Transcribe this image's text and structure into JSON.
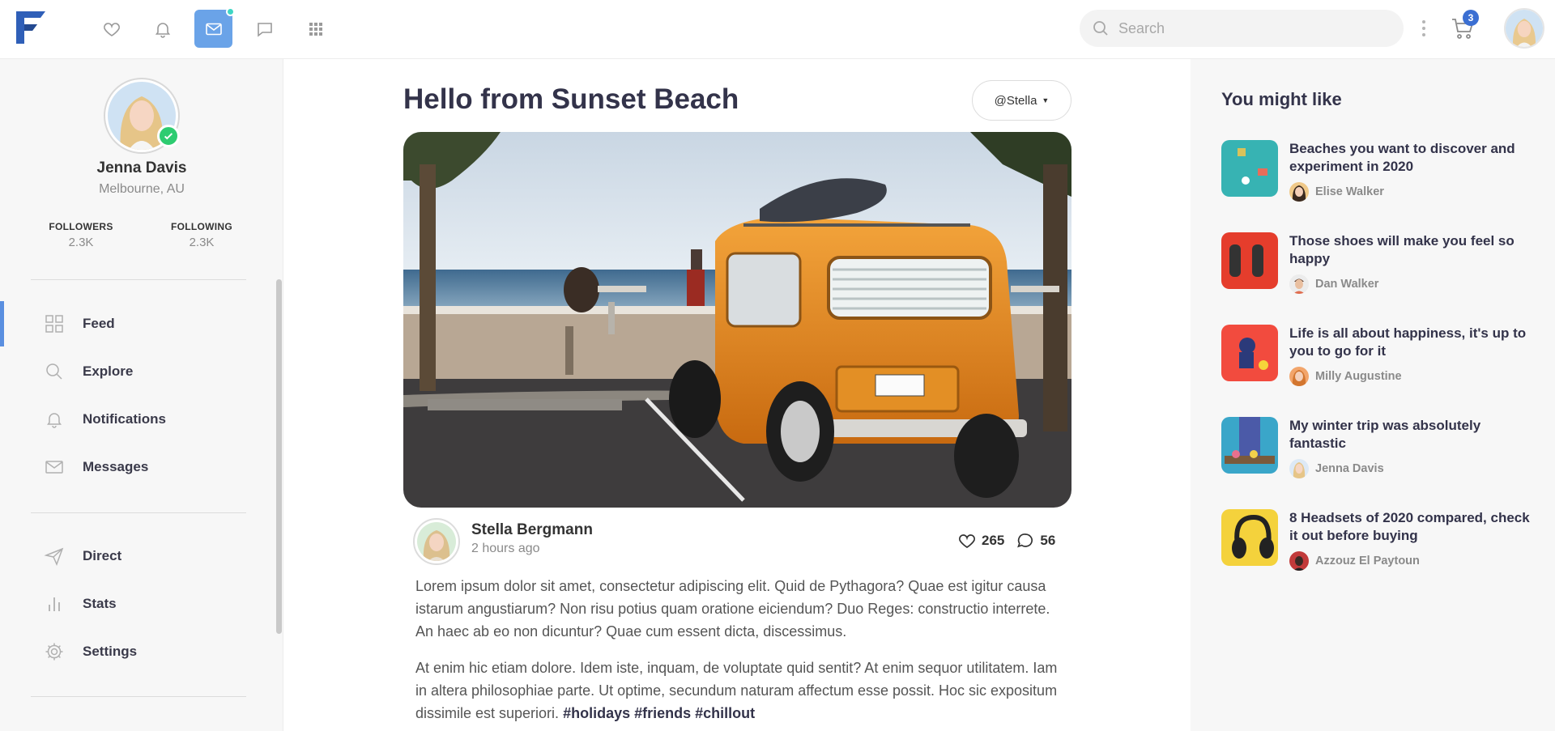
{
  "topbar": {
    "logo": "F-logo",
    "nav": [
      {
        "icon": "heart-icon",
        "active": false
      },
      {
        "icon": "bell-icon",
        "active": false
      },
      {
        "icon": "envelope-icon",
        "active": true,
        "dot": true
      },
      {
        "icon": "chat-bubble-icon",
        "active": false
      },
      {
        "icon": "apps-grid-icon",
        "active": false
      }
    ],
    "search": {
      "placeholder": "Search",
      "value": ""
    },
    "cart_count": "3",
    "accent": "#6aa3e8",
    "dot_color": "#3ed6c4"
  },
  "sidebar": {
    "profile": {
      "name": "Jenna Davis",
      "location": "Melbourne, AU",
      "verified": true
    },
    "stats": [
      {
        "label": "FOLLOWERS",
        "value": "2.3K"
      },
      {
        "label": "FOLLOWING",
        "value": "2.3K"
      }
    ],
    "menu": [
      {
        "label": "Feed",
        "icon": "grid-icon",
        "active": true
      },
      {
        "label": "Explore",
        "icon": "search-icon",
        "active": false
      },
      {
        "label": "Notifications",
        "icon": "bell-icon",
        "active": false
      },
      {
        "label": "Messages",
        "icon": "envelope-icon",
        "active": false
      }
    ],
    "menu2": [
      {
        "label": "Direct",
        "icon": "send-icon"
      },
      {
        "label": "Stats",
        "icon": "bar-chart-icon"
      },
      {
        "label": "Settings",
        "icon": "gear-icon"
      }
    ]
  },
  "post": {
    "title": "Hello from Sunset Beach",
    "author_select": "@Stella",
    "author": "Stella Bergmann",
    "time": "2 hours ago",
    "likes": "265",
    "comments": "56",
    "paragraph1": "Lorem ipsum dolor sit amet, consectetur adipiscing elit. Quid de Pythagora? Quae est igitur causa istarum angustiarum? Non risu potius quam oratione eiciendum? Duo Reges: constructio interrete. An haec ab eo non dicuntur? Quae cum essent dicta, discessimus.",
    "paragraph2": "At enim hic etiam dolore. Idem iste, inquam, de voluptate quid sentit? At enim sequor utilitatem. Iam in altera philosophiae parte. Ut optime, secundum naturam affectum esse possit. Hoc sic expositum dissimile est superiori.",
    "hashtags": "#holidays #friends #chillout"
  },
  "suggestions": {
    "title": "You might like",
    "items": [
      {
        "title": "Beaches you want to discover and experiment in 2020",
        "author": "Elise Walker",
        "thumb": "teal"
      },
      {
        "title": "Those shoes will make you feel so happy",
        "author": "Dan Walker",
        "thumb": "red"
      },
      {
        "title": "Life is all about happiness, it's up to you to go for it",
        "author": "Milly Augustine",
        "thumb": "coral"
      },
      {
        "title": "My winter trip was absolutely fantastic",
        "author": "Jenna Davis",
        "thumb": "blue"
      },
      {
        "title": "8 Headsets of 2020 compared, check it out before buying",
        "author": "Azzouz El Paytoun",
        "thumb": "yellow"
      }
    ]
  }
}
